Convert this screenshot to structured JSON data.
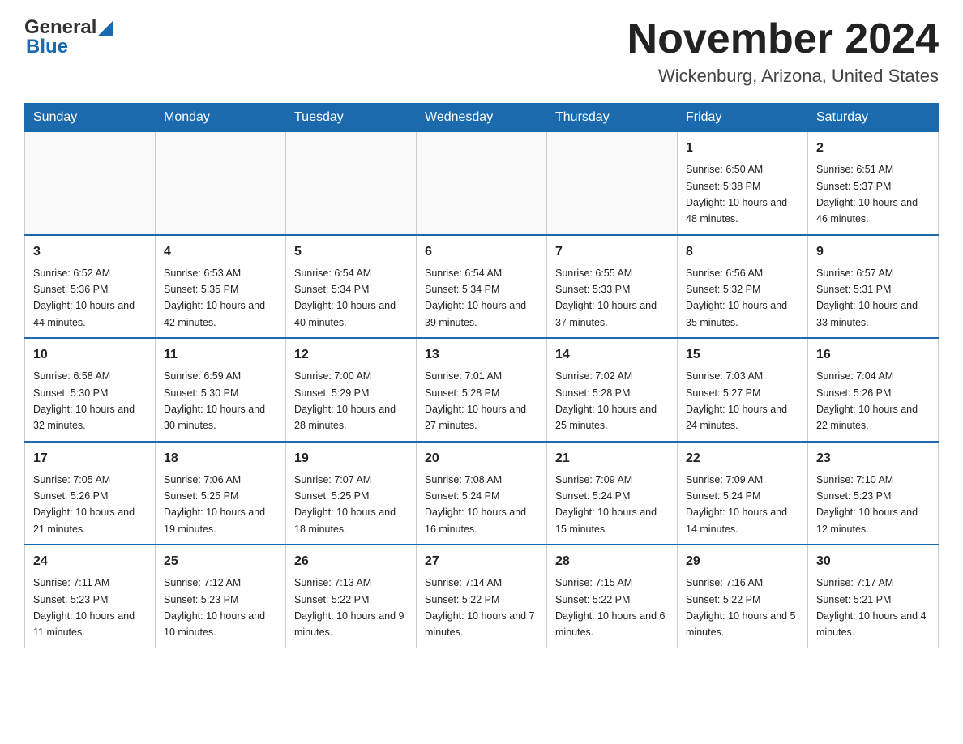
{
  "header": {
    "logo_general": "General",
    "logo_blue": "Blue",
    "title": "November 2024",
    "subtitle": "Wickenburg, Arizona, United States"
  },
  "calendar": {
    "days_of_week": [
      "Sunday",
      "Monday",
      "Tuesday",
      "Wednesday",
      "Thursday",
      "Friday",
      "Saturday"
    ],
    "weeks": [
      [
        {
          "day": "",
          "info": ""
        },
        {
          "day": "",
          "info": ""
        },
        {
          "day": "",
          "info": ""
        },
        {
          "day": "",
          "info": ""
        },
        {
          "day": "",
          "info": ""
        },
        {
          "day": "1",
          "info": "Sunrise: 6:50 AM\nSunset: 5:38 PM\nDaylight: 10 hours and 48 minutes."
        },
        {
          "day": "2",
          "info": "Sunrise: 6:51 AM\nSunset: 5:37 PM\nDaylight: 10 hours and 46 minutes."
        }
      ],
      [
        {
          "day": "3",
          "info": "Sunrise: 6:52 AM\nSunset: 5:36 PM\nDaylight: 10 hours and 44 minutes."
        },
        {
          "day": "4",
          "info": "Sunrise: 6:53 AM\nSunset: 5:35 PM\nDaylight: 10 hours and 42 minutes."
        },
        {
          "day": "5",
          "info": "Sunrise: 6:54 AM\nSunset: 5:34 PM\nDaylight: 10 hours and 40 minutes."
        },
        {
          "day": "6",
          "info": "Sunrise: 6:54 AM\nSunset: 5:34 PM\nDaylight: 10 hours and 39 minutes."
        },
        {
          "day": "7",
          "info": "Sunrise: 6:55 AM\nSunset: 5:33 PM\nDaylight: 10 hours and 37 minutes."
        },
        {
          "day": "8",
          "info": "Sunrise: 6:56 AM\nSunset: 5:32 PM\nDaylight: 10 hours and 35 minutes."
        },
        {
          "day": "9",
          "info": "Sunrise: 6:57 AM\nSunset: 5:31 PM\nDaylight: 10 hours and 33 minutes."
        }
      ],
      [
        {
          "day": "10",
          "info": "Sunrise: 6:58 AM\nSunset: 5:30 PM\nDaylight: 10 hours and 32 minutes."
        },
        {
          "day": "11",
          "info": "Sunrise: 6:59 AM\nSunset: 5:30 PM\nDaylight: 10 hours and 30 minutes."
        },
        {
          "day": "12",
          "info": "Sunrise: 7:00 AM\nSunset: 5:29 PM\nDaylight: 10 hours and 28 minutes."
        },
        {
          "day": "13",
          "info": "Sunrise: 7:01 AM\nSunset: 5:28 PM\nDaylight: 10 hours and 27 minutes."
        },
        {
          "day": "14",
          "info": "Sunrise: 7:02 AM\nSunset: 5:28 PM\nDaylight: 10 hours and 25 minutes."
        },
        {
          "day": "15",
          "info": "Sunrise: 7:03 AM\nSunset: 5:27 PM\nDaylight: 10 hours and 24 minutes."
        },
        {
          "day": "16",
          "info": "Sunrise: 7:04 AM\nSunset: 5:26 PM\nDaylight: 10 hours and 22 minutes."
        }
      ],
      [
        {
          "day": "17",
          "info": "Sunrise: 7:05 AM\nSunset: 5:26 PM\nDaylight: 10 hours and 21 minutes."
        },
        {
          "day": "18",
          "info": "Sunrise: 7:06 AM\nSunset: 5:25 PM\nDaylight: 10 hours and 19 minutes."
        },
        {
          "day": "19",
          "info": "Sunrise: 7:07 AM\nSunset: 5:25 PM\nDaylight: 10 hours and 18 minutes."
        },
        {
          "day": "20",
          "info": "Sunrise: 7:08 AM\nSunset: 5:24 PM\nDaylight: 10 hours and 16 minutes."
        },
        {
          "day": "21",
          "info": "Sunrise: 7:09 AM\nSunset: 5:24 PM\nDaylight: 10 hours and 15 minutes."
        },
        {
          "day": "22",
          "info": "Sunrise: 7:09 AM\nSunset: 5:24 PM\nDaylight: 10 hours and 14 minutes."
        },
        {
          "day": "23",
          "info": "Sunrise: 7:10 AM\nSunset: 5:23 PM\nDaylight: 10 hours and 12 minutes."
        }
      ],
      [
        {
          "day": "24",
          "info": "Sunrise: 7:11 AM\nSunset: 5:23 PM\nDaylight: 10 hours and 11 minutes."
        },
        {
          "day": "25",
          "info": "Sunrise: 7:12 AM\nSunset: 5:23 PM\nDaylight: 10 hours and 10 minutes."
        },
        {
          "day": "26",
          "info": "Sunrise: 7:13 AM\nSunset: 5:22 PM\nDaylight: 10 hours and 9 minutes."
        },
        {
          "day": "27",
          "info": "Sunrise: 7:14 AM\nSunset: 5:22 PM\nDaylight: 10 hours and 7 minutes."
        },
        {
          "day": "28",
          "info": "Sunrise: 7:15 AM\nSunset: 5:22 PM\nDaylight: 10 hours and 6 minutes."
        },
        {
          "day": "29",
          "info": "Sunrise: 7:16 AM\nSunset: 5:22 PM\nDaylight: 10 hours and 5 minutes."
        },
        {
          "day": "30",
          "info": "Sunrise: 7:17 AM\nSunset: 5:21 PM\nDaylight: 10 hours and 4 minutes."
        }
      ]
    ]
  }
}
